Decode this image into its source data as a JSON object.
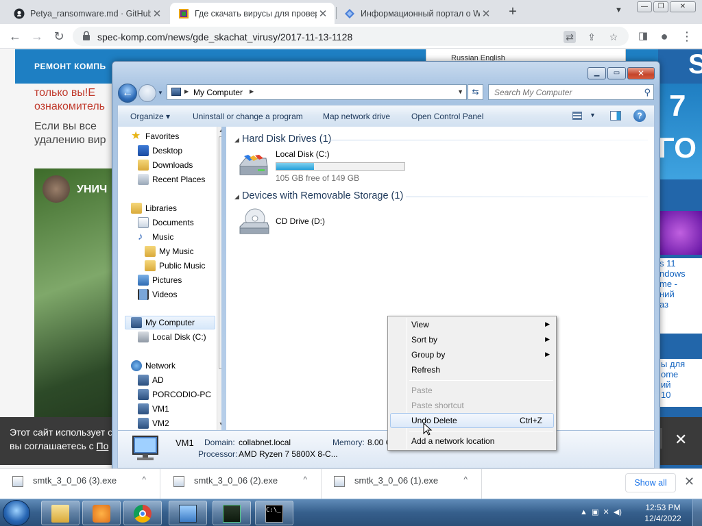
{
  "browser": {
    "tabs": [
      {
        "title": "Petya_ransomware.md · GitHub",
        "active": false
      },
      {
        "title": "Где скачать вирусы для провер",
        "active": true
      },
      {
        "title": "Информационный портал о W",
        "active": false
      }
    ],
    "new_tab": "+",
    "url": "spec-komp.com/news/gde_skachat_virusy/2017-11-13-1128"
  },
  "webpage": {
    "nav_text": "РЕМОНТ КОМПЬ",
    "red_text_1": "только   вы!Е",
    "red_text_2": "ознакомитель",
    "gray_text_1": "Если вы все",
    "gray_text_2": "удалению вир",
    "video_title": "УНИЧ",
    "translate_popup": "Russian      English",
    "ad_num": "7",
    "ad_go": "ГО",
    "ad_letter": "S",
    "side_text": "s 11\nndows\nme -\nний\nаз",
    "side_text2": "ы для\nome\nий\n10",
    "cookie_line1": "Этот сайт использует с",
    "cookie_line2": "вы соглашаетесь с",
    "cookie_link": "По",
    "cookie_close": "✕"
  },
  "explorer": {
    "address": "My Computer",
    "search_placeholder": "Search My Computer",
    "commands": {
      "organize": "Organize",
      "uninstall": "Uninstall or change a program",
      "map_drive": "Map network drive",
      "control_panel": "Open Control Panel"
    },
    "nav": {
      "favorites": "Favorites",
      "desktop": "Desktop",
      "downloads": "Downloads",
      "recent": "Recent Places",
      "libraries": "Libraries",
      "documents": "Documents",
      "music": "Music",
      "my_music": "My Music",
      "public_music": "Public Music",
      "pictures": "Pictures",
      "videos": "Videos",
      "my_computer": "My Computer",
      "local_disk": "Local Disk (C:)",
      "network": "Network",
      "ad": "AD",
      "porcodio": "PORCODIO-PC",
      "vm1": "VM1",
      "vm2": "VM2"
    },
    "groups": {
      "hdd": "Hard Disk Drives (1)",
      "removable": "Devices with Removable Storage (1)"
    },
    "drives": {
      "c_name": "Local Disk (C:)",
      "c_free": "105 GB free of 149 GB",
      "c_used_fraction": 0.295,
      "d_name": "CD Drive (D:)"
    },
    "details": {
      "name": "VM1",
      "domain_label": "Domain:",
      "domain": "collabnet.local",
      "memory_label": "Memory:",
      "memory": "8.00 GB",
      "processor_label": "Processor:",
      "processor": "AMD Ryzen 7 5800X 8-C..."
    }
  },
  "context_menu": {
    "view": "View",
    "sort_by": "Sort by",
    "group_by": "Group by",
    "refresh": "Refresh",
    "paste": "Paste",
    "paste_shortcut": "Paste shortcut",
    "undo_delete": "Undo Delete",
    "undo_shortcut": "Ctrl+Z",
    "add_network": "Add a network location"
  },
  "downloads": {
    "items": [
      "smtk_3_0_06 (3).exe",
      "smtk_3_0_06 (2).exe",
      "smtk_3_0_06 (1).exe"
    ],
    "show_all": "Show all"
  },
  "taskbar": {
    "time": "12:53 PM",
    "date": "12/4/2022"
  },
  "colors": {
    "chrome_bg": "#dee1e6",
    "site_blue": "#1e7fc3",
    "explorer_frame": "#a7c3e2",
    "disk_bar": "#26a0da"
  }
}
